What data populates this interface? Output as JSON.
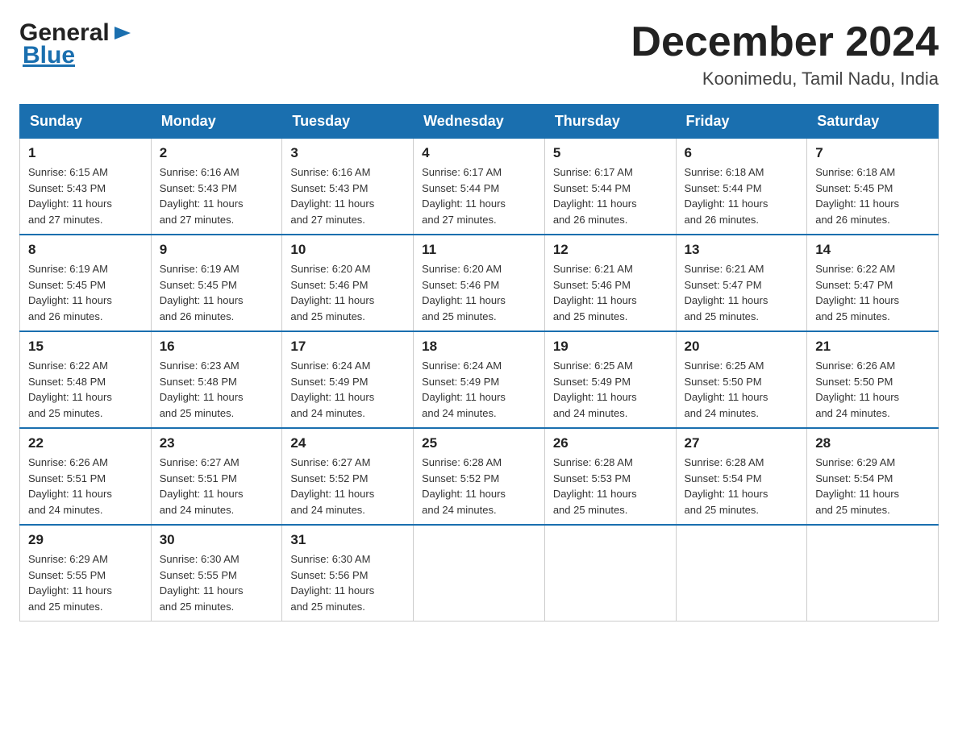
{
  "logo": {
    "general": "General",
    "blue": "Blue"
  },
  "header": {
    "month": "December 2024",
    "location": "Koonimedu, Tamil Nadu, India"
  },
  "days_of_week": [
    "Sunday",
    "Monday",
    "Tuesday",
    "Wednesday",
    "Thursday",
    "Friday",
    "Saturday"
  ],
  "weeks": [
    [
      {
        "day": 1,
        "sunrise": "6:15 AM",
        "sunset": "5:43 PM",
        "daylight": "11 hours and 27 minutes."
      },
      {
        "day": 2,
        "sunrise": "6:16 AM",
        "sunset": "5:43 PM",
        "daylight": "11 hours and 27 minutes."
      },
      {
        "day": 3,
        "sunrise": "6:16 AM",
        "sunset": "5:43 PM",
        "daylight": "11 hours and 27 minutes."
      },
      {
        "day": 4,
        "sunrise": "6:17 AM",
        "sunset": "5:44 PM",
        "daylight": "11 hours and 27 minutes."
      },
      {
        "day": 5,
        "sunrise": "6:17 AM",
        "sunset": "5:44 PM",
        "daylight": "11 hours and 26 minutes."
      },
      {
        "day": 6,
        "sunrise": "6:18 AM",
        "sunset": "5:44 PM",
        "daylight": "11 hours and 26 minutes."
      },
      {
        "day": 7,
        "sunrise": "6:18 AM",
        "sunset": "5:45 PM",
        "daylight": "11 hours and 26 minutes."
      }
    ],
    [
      {
        "day": 8,
        "sunrise": "6:19 AM",
        "sunset": "5:45 PM",
        "daylight": "11 hours and 26 minutes."
      },
      {
        "day": 9,
        "sunrise": "6:19 AM",
        "sunset": "5:45 PM",
        "daylight": "11 hours and 26 minutes."
      },
      {
        "day": 10,
        "sunrise": "6:20 AM",
        "sunset": "5:46 PM",
        "daylight": "11 hours and 25 minutes."
      },
      {
        "day": 11,
        "sunrise": "6:20 AM",
        "sunset": "5:46 PM",
        "daylight": "11 hours and 25 minutes."
      },
      {
        "day": 12,
        "sunrise": "6:21 AM",
        "sunset": "5:46 PM",
        "daylight": "11 hours and 25 minutes."
      },
      {
        "day": 13,
        "sunrise": "6:21 AM",
        "sunset": "5:47 PM",
        "daylight": "11 hours and 25 minutes."
      },
      {
        "day": 14,
        "sunrise": "6:22 AM",
        "sunset": "5:47 PM",
        "daylight": "11 hours and 25 minutes."
      }
    ],
    [
      {
        "day": 15,
        "sunrise": "6:22 AM",
        "sunset": "5:48 PM",
        "daylight": "11 hours and 25 minutes."
      },
      {
        "day": 16,
        "sunrise": "6:23 AM",
        "sunset": "5:48 PM",
        "daylight": "11 hours and 25 minutes."
      },
      {
        "day": 17,
        "sunrise": "6:24 AM",
        "sunset": "5:49 PM",
        "daylight": "11 hours and 24 minutes."
      },
      {
        "day": 18,
        "sunrise": "6:24 AM",
        "sunset": "5:49 PM",
        "daylight": "11 hours and 24 minutes."
      },
      {
        "day": 19,
        "sunrise": "6:25 AM",
        "sunset": "5:49 PM",
        "daylight": "11 hours and 24 minutes."
      },
      {
        "day": 20,
        "sunrise": "6:25 AM",
        "sunset": "5:50 PM",
        "daylight": "11 hours and 24 minutes."
      },
      {
        "day": 21,
        "sunrise": "6:26 AM",
        "sunset": "5:50 PM",
        "daylight": "11 hours and 24 minutes."
      }
    ],
    [
      {
        "day": 22,
        "sunrise": "6:26 AM",
        "sunset": "5:51 PM",
        "daylight": "11 hours and 24 minutes."
      },
      {
        "day": 23,
        "sunrise": "6:27 AM",
        "sunset": "5:51 PM",
        "daylight": "11 hours and 24 minutes."
      },
      {
        "day": 24,
        "sunrise": "6:27 AM",
        "sunset": "5:52 PM",
        "daylight": "11 hours and 24 minutes."
      },
      {
        "day": 25,
        "sunrise": "6:28 AM",
        "sunset": "5:52 PM",
        "daylight": "11 hours and 24 minutes."
      },
      {
        "day": 26,
        "sunrise": "6:28 AM",
        "sunset": "5:53 PM",
        "daylight": "11 hours and 25 minutes."
      },
      {
        "day": 27,
        "sunrise": "6:28 AM",
        "sunset": "5:54 PM",
        "daylight": "11 hours and 25 minutes."
      },
      {
        "day": 28,
        "sunrise": "6:29 AM",
        "sunset": "5:54 PM",
        "daylight": "11 hours and 25 minutes."
      }
    ],
    [
      {
        "day": 29,
        "sunrise": "6:29 AM",
        "sunset": "5:55 PM",
        "daylight": "11 hours and 25 minutes."
      },
      {
        "day": 30,
        "sunrise": "6:30 AM",
        "sunset": "5:55 PM",
        "daylight": "11 hours and 25 minutes."
      },
      {
        "day": 31,
        "sunrise": "6:30 AM",
        "sunset": "5:56 PM",
        "daylight": "11 hours and 25 minutes."
      },
      null,
      null,
      null,
      null
    ]
  ],
  "labels": {
    "sunrise": "Sunrise:",
    "sunset": "Sunset:",
    "daylight": "Daylight:"
  }
}
